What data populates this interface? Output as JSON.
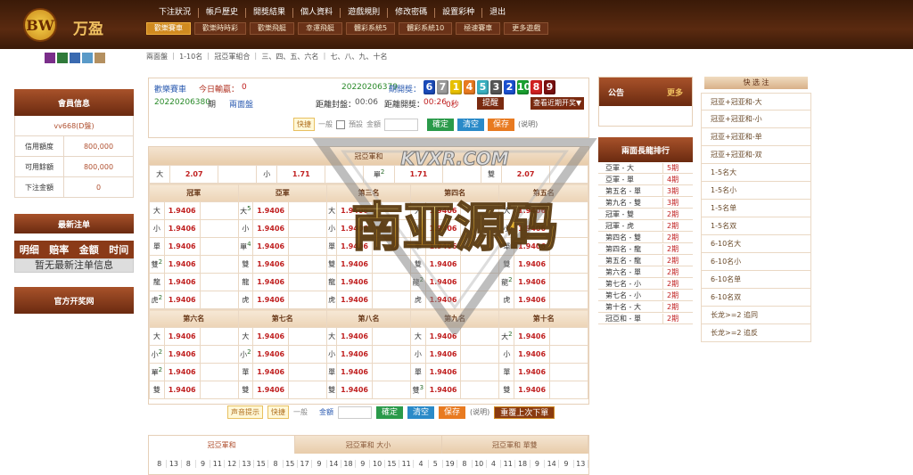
{
  "header": {
    "logo_badge": "BW",
    "logo_text": "万盈",
    "nav": [
      "下注狀況",
      "帳戶歷史",
      "開獎結果",
      "個人資料",
      "遊戲規則",
      "修改密碼",
      "設置彩种",
      "退出"
    ],
    "games": [
      "歡樂賽車",
      "歡樂時時彩",
      "歡樂飛艇",
      "幸運飛艇",
      "體彩系統5",
      "體彩系統10",
      "極速賽車",
      "更多遊戲"
    ],
    "active_game": 0
  },
  "swatches": [
    "#7a2e8a",
    "#2f7a3a",
    "#3a6ab0",
    "#5a9ac8",
    "#b49060"
  ],
  "crumbs": "兩面盤 ｜ 1-10名 ｜ 冠亞軍組合 ｜ 三、四、五、六名 ｜ 七、八、九、十名",
  "member": {
    "title": "會員信息",
    "account": "vv668(D盤)",
    "rows": [
      {
        "label": "信用額度",
        "value": "800,000"
      },
      {
        "label": "可用餘額",
        "value": "800,000"
      },
      {
        "label": "下注金額",
        "value": "0"
      }
    ]
  },
  "latest": {
    "title": "最新注单",
    "cols": [
      "明细",
      "赔率",
      "金额",
      "时间"
    ],
    "empty": "暂无最新注单信息"
  },
  "official": {
    "title": "官方开奖网"
  },
  "info": {
    "game": "歡樂賽車",
    "today_label": "今日輸贏：",
    "today_value": "0",
    "prev_draw": "20220206379",
    "prev_label": "期開獎：",
    "balls": [
      {
        "n": "6",
        "c": "#1a4ab8"
      },
      {
        "n": "7",
        "c": "#9a9a9a"
      },
      {
        "n": "1",
        "c": "#e8c000"
      },
      {
        "n": "4",
        "c": "#e87a20"
      },
      {
        "n": "5",
        "c": "#3ab0c0"
      },
      {
        "n": "3",
        "c": "#555555"
      },
      {
        "n": "2",
        "c": "#1a50d0"
      },
      {
        "n": "10",
        "c": "#1aa030"
      },
      {
        "n": "8",
        "c": "#d02020"
      },
      {
        "n": "9",
        "c": "#7a1010"
      }
    ],
    "cur_draw": "20220206380",
    "cur_label": "期",
    "mode": "兩面盤",
    "close_label": "距離封盤：",
    "close_time": "00:06",
    "draw_label": "距離開獎：",
    "draw_time": "00:26",
    "draw_suffix": "0秒",
    "remind": "提醒",
    "view_recent": "查看近期开奖▼",
    "quick": "快捷",
    "normal": "一般",
    "preset": "預設",
    "amount": "金額",
    "confirm": "確定",
    "clear": "清空",
    "save": "保存",
    "explain": "(说明)"
  },
  "champion_sum": {
    "title": "冠亞軍和",
    "cells": [
      {
        "k": "大",
        "v": "2.07"
      },
      {
        "k": "小",
        "v": "1.71"
      },
      {
        "k": "單",
        "sup": "2",
        "v": "1.71"
      },
      {
        "k": "雙",
        "v": "2.07"
      }
    ]
  },
  "groupA": {
    "heads": [
      "冠軍",
      "亞軍",
      "第三名",
      "第四名",
      "第五名"
    ],
    "rows": [
      [
        {
          "k": "大",
          "v": "1.9406"
        },
        {
          "k": "大",
          "sup": "5",
          "v": "1.9406"
        },
        {
          "k": "大",
          "v": "1.9406"
        },
        {
          "k": "大",
          "v": "1.9406"
        },
        {
          "k": "大",
          "v": "1.9406"
        }
      ],
      [
        {
          "k": "小",
          "v": "1.9406"
        },
        {
          "k": "小",
          "v": "1.9406"
        },
        {
          "k": "小",
          "v": "1.9406"
        },
        {
          "k": "小",
          "v": "1.9406"
        },
        {
          "k": "小",
          "v": "1.9406"
        }
      ],
      [
        {
          "k": "單",
          "v": "1.9406"
        },
        {
          "k": "單",
          "sup": "4",
          "v": "1.9406"
        },
        {
          "k": "單",
          "v": "1.9406"
        },
        {
          "k": "單",
          "v": "1.9406"
        },
        {
          "k": "單",
          "v": "1.9406"
        }
      ],
      [
        {
          "k": "雙",
          "sup": "2",
          "v": "1.9406"
        },
        {
          "k": "雙",
          "v": "1.9406"
        },
        {
          "k": "雙",
          "v": "1.9406"
        },
        {
          "k": "雙",
          "v": "1.9406"
        },
        {
          "k": "雙",
          "v": "1.9406"
        }
      ],
      [
        {
          "k": "龍",
          "v": "1.9406"
        },
        {
          "k": "龍",
          "v": "1.9406"
        },
        {
          "k": "龍",
          "v": "1.9406"
        },
        {
          "k": "龍",
          "sup": "2",
          "v": "1.9406"
        },
        {
          "k": "龍",
          "sup": "2",
          "v": "1.9406"
        }
      ],
      [
        {
          "k": "虎",
          "sup": "2",
          "v": "1.9406"
        },
        {
          "k": "虎",
          "v": "1.9406"
        },
        {
          "k": "虎",
          "v": "1.9406"
        },
        {
          "k": "虎",
          "v": "1.9406"
        },
        {
          "k": "虎",
          "v": "1.9406"
        }
      ]
    ]
  },
  "groupB": {
    "heads": [
      "第六名",
      "第七名",
      "第八名",
      "第九名",
      "第十名"
    ],
    "rows": [
      [
        {
          "k": "大",
          "v": "1.9406"
        },
        {
          "k": "大",
          "v": "1.9406"
        },
        {
          "k": "大",
          "v": "1.9406"
        },
        {
          "k": "大",
          "v": "1.9406"
        },
        {
          "k": "大",
          "sup": "2",
          "v": "1.9406"
        }
      ],
      [
        {
          "k": "小",
          "sup": "2",
          "v": "1.9406"
        },
        {
          "k": "小",
          "sup": "2",
          "v": "1.9406"
        },
        {
          "k": "小",
          "v": "1.9406"
        },
        {
          "k": "小",
          "v": "1.9406"
        },
        {
          "k": "小",
          "v": "1.9406"
        }
      ],
      [
        {
          "k": "單",
          "sup": "2",
          "v": "1.9406"
        },
        {
          "k": "單",
          "v": "1.9406"
        },
        {
          "k": "單",
          "v": "1.9406"
        },
        {
          "k": "單",
          "v": "1.9406"
        },
        {
          "k": "單",
          "v": "1.9406"
        }
      ],
      [
        {
          "k": "雙",
          "v": "1.9406"
        },
        {
          "k": "雙",
          "v": "1.9406"
        },
        {
          "k": "雙",
          "v": "1.9406"
        },
        {
          "k": "雙",
          "sup": "3",
          "v": "1.9406"
        },
        {
          "k": "雙",
          "v": "1.9406"
        }
      ]
    ]
  },
  "bottom": {
    "sound": "声音提示",
    "quick": "快捷",
    "normal": "一般",
    "amount": "金額",
    "confirm": "確定",
    "clear": "清空",
    "save": "保存",
    "explain": "(说明)",
    "repeat": "重覆上次下單"
  },
  "tabs": [
    "冠亞軍和",
    "冠亞軍和 大小",
    "冠亞軍和 單雙"
  ],
  "numstrip": [
    "8",
    "13",
    "8",
    "9",
    "11",
    "12",
    "13",
    "15",
    "8",
    "15",
    "17",
    "9",
    "14",
    "18",
    "9",
    "10",
    "15",
    "11",
    "4",
    "5",
    "19",
    "8",
    "10",
    "4",
    "11",
    "18",
    "9",
    "14",
    "9",
    "13"
  ],
  "notice": {
    "title": "公告",
    "more": "更多"
  },
  "ranking": {
    "title": "兩面長龍排行",
    "rows": [
      {
        "k": "亞軍 - 大",
        "v": "5期"
      },
      {
        "k": "亞軍 - 單",
        "v": "4期"
      },
      {
        "k": "第五名 - 單",
        "v": "3期"
      },
      {
        "k": "第九名 - 雙",
        "v": "3期"
      },
      {
        "k": "冠軍 - 雙",
        "v": "2期"
      },
      {
        "k": "冠軍 - 虎",
        "v": "2期"
      },
      {
        "k": "第四名 - 雙",
        "v": "2期"
      },
      {
        "k": "第四名 - 龍",
        "v": "2期"
      },
      {
        "k": "第五名 - 龍",
        "v": "2期"
      },
      {
        "k": "第六名 - 單",
        "v": "2期"
      },
      {
        "k": "第七名 - 小",
        "v": "2期"
      },
      {
        "k": "第七名 - 小",
        "v": "2期"
      },
      {
        "k": "第十名 - 大",
        "v": "2期"
      },
      {
        "k": "冠亞和 - 單",
        "v": "2期"
      }
    ]
  },
  "quickbet": {
    "title": "快 选 注",
    "items": [
      "冠亚+冠亚和-大",
      "冠亚+冠亚和-小",
      "冠亚+冠亚和-单",
      "冠亚+冠亚和-双",
      "1-5名大",
      "1-5名小",
      "1-5名单",
      "1-5名双",
      "6-10名大",
      "6-10名小",
      "6-10名单",
      "6-10名双",
      "长龙>=2 追同",
      "长龙>=2 追反"
    ]
  },
  "watermark": {
    "top": "KVXR.COM",
    "main": "南亚源码"
  },
  "colors": {
    "accent": "#d08a20",
    "header": "#3a1a08",
    "odds": "#c02020",
    "confirm": "#2a9a4a",
    "clear": "#2a8ac8",
    "save": "#e87a20"
  }
}
